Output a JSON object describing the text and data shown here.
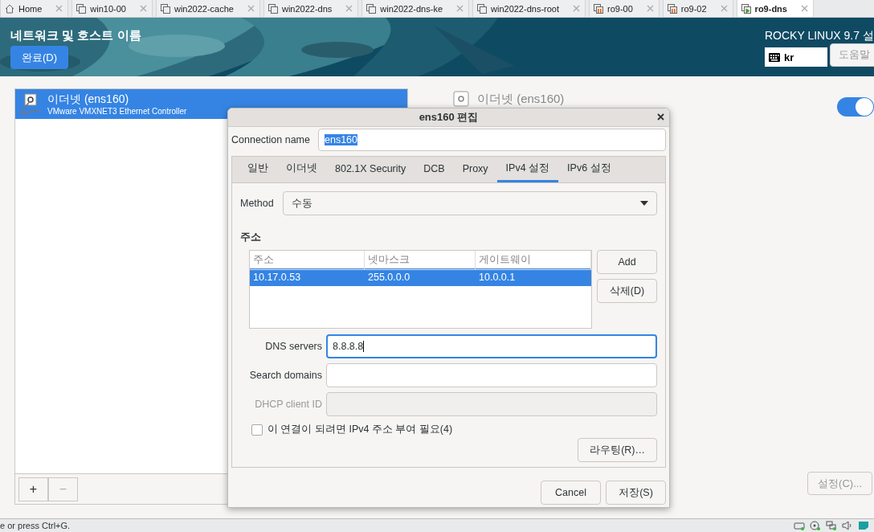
{
  "vm_tabs": [
    {
      "label": "Home",
      "kind": "home",
      "selected": false
    },
    {
      "label": "win10-00",
      "kind": "vm",
      "selected": false
    },
    {
      "label": "win2022-cache",
      "kind": "vm",
      "selected": false
    },
    {
      "label": "win2022-dns",
      "kind": "vm",
      "selected": false
    },
    {
      "label": "win2022-dns-ke",
      "kind": "vm",
      "selected": false
    },
    {
      "label": "win2022-dns-root",
      "kind": "vm",
      "selected": false
    },
    {
      "label": "ro9-00",
      "kind": "paused",
      "selected": false
    },
    {
      "label": "ro9-02",
      "kind": "paused",
      "selected": false
    },
    {
      "label": "ro9-dns",
      "kind": "running",
      "selected": true
    }
  ],
  "header": {
    "title": "네트워크 및 호스트 이름",
    "done_button": "완료(D)",
    "product": "ROCKY LINUX 9.7 설",
    "keyboard": "kr",
    "help_button": "도움말"
  },
  "connections": [
    {
      "name": "이더넷 (ens160)",
      "description": "VMware VMXNET3 Ethernet Controller",
      "selected": true
    }
  ],
  "list_toolbar": [
    {
      "label": "+",
      "disabled": false
    },
    {
      "label": "−",
      "disabled": true
    }
  ],
  "device": {
    "name": "이더넷 (ens160)",
    "on": true,
    "configure_button": "설정(C)...",
    "configure_disabled": true
  },
  "dialog": {
    "title": "ens160 편집",
    "connection_name_label": "Connection name",
    "connection_name": "ens160",
    "connection_name_highlighted": true,
    "tabs": [
      {
        "label": "일반",
        "selected": false
      },
      {
        "label": "이더넷",
        "selected": false
      },
      {
        "label": "802.1X Security",
        "selected": false
      },
      {
        "label": "DCB",
        "selected": false
      },
      {
        "label": "Proxy",
        "selected": false
      },
      {
        "label": "IPv4 설정",
        "selected": true
      },
      {
        "label": "IPv6 설정",
        "selected": false
      }
    ],
    "method_label": "Method",
    "method": "수동",
    "address_heading": "주소",
    "address_columns": [
      "주소",
      "넷마스크",
      "게이트웨이"
    ],
    "addresses": [
      {
        "cells": [
          "10.17.0.53",
          "255.0.0.0",
          "10.0.0.1"
        ],
        "selected": true
      }
    ],
    "address_buttons": [
      "Add",
      "삭제(D)"
    ],
    "fields": [
      {
        "label": "DNS servers",
        "value": "8.8.8.8",
        "focused": true,
        "disabled": false
      },
      {
        "label": "Search domains",
        "focused": false,
        "disabled": false
      },
      {
        "label": "DHCP client ID",
        "focused": false,
        "disabled": true
      }
    ],
    "require_ipv4": {
      "label": "이 연결이 되려면 IPv4 주소 부여 필요(4)",
      "checked": false
    },
    "routes_button": "라우팅(R)…",
    "buttons": [
      "Cancel",
      "저장(S)"
    ]
  },
  "status_bar": {
    "hint": "e or press Ctrl+G."
  }
}
